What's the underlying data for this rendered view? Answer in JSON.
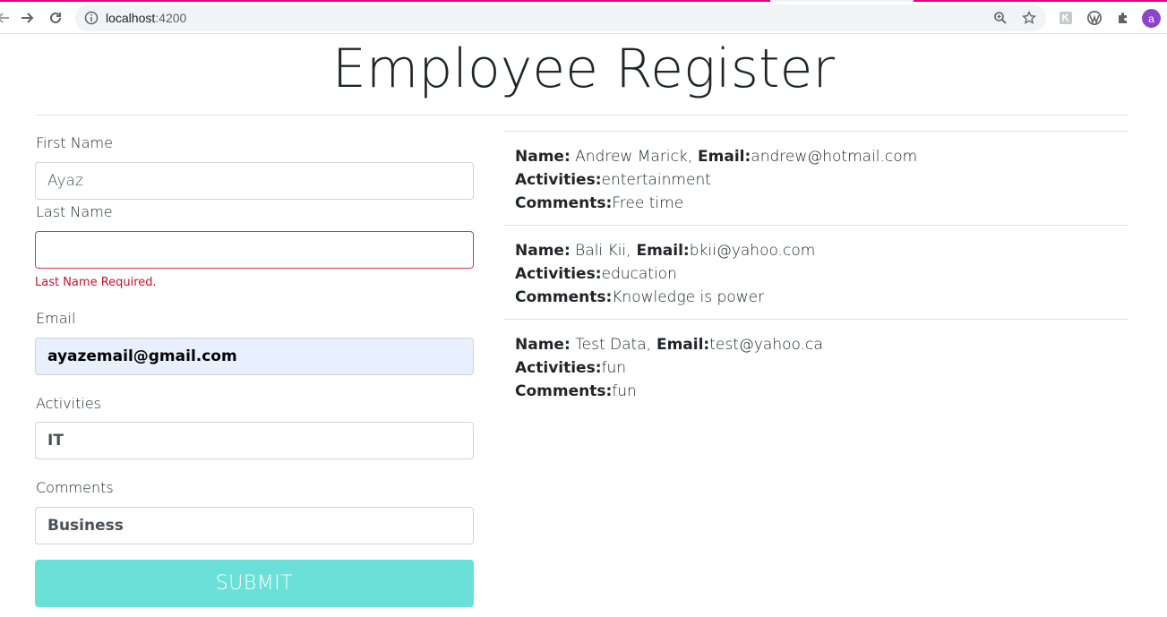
{
  "browser": {
    "url_host": "localhost",
    "url_port": ":4200",
    "profile_initial": "a"
  },
  "page": {
    "title": "Employee Register"
  },
  "form": {
    "first_name": {
      "label": "First Name",
      "value": "Ayaz"
    },
    "last_name": {
      "label": "Last Name",
      "value": "",
      "error": "Last Name Required."
    },
    "email": {
      "label": "Email",
      "value": "ayazemail@gmail.com"
    },
    "activities": {
      "label": "Activities",
      "value": "IT"
    },
    "comments": {
      "label": "Comments",
      "value": "Business"
    },
    "submit_label": "SUBMIT"
  },
  "employees": [
    {
      "name_label": "Name:",
      "name": " Andrew Marick,",
      "email_label": " Email:",
      "email": "andrew@hotmail.com",
      "activities_label": "Activities:",
      "activities": "entertainment",
      "comments_label": "Comments:",
      "comments": "Free time"
    },
    {
      "name_label": "Name:",
      "name": " Bali Kii,",
      "email_label": " Email:",
      "email": "bkii@yahoo.com",
      "activities_label": "Activities:",
      "activities": "education",
      "comments_label": "Comments:",
      "comments": "Knowledge is power"
    },
    {
      "name_label": "Name:",
      "name": " Test Data,",
      "email_label": " Email:",
      "email": "test@yahoo.ca",
      "activities_label": "Activities:",
      "activities": "fun",
      "comments_label": "Comments:",
      "comments": "fun"
    }
  ],
  "colors": {
    "submit_bg": "#6ae0d8",
    "error": "#c8102e",
    "autofill_bg": "#e8f0fe"
  }
}
